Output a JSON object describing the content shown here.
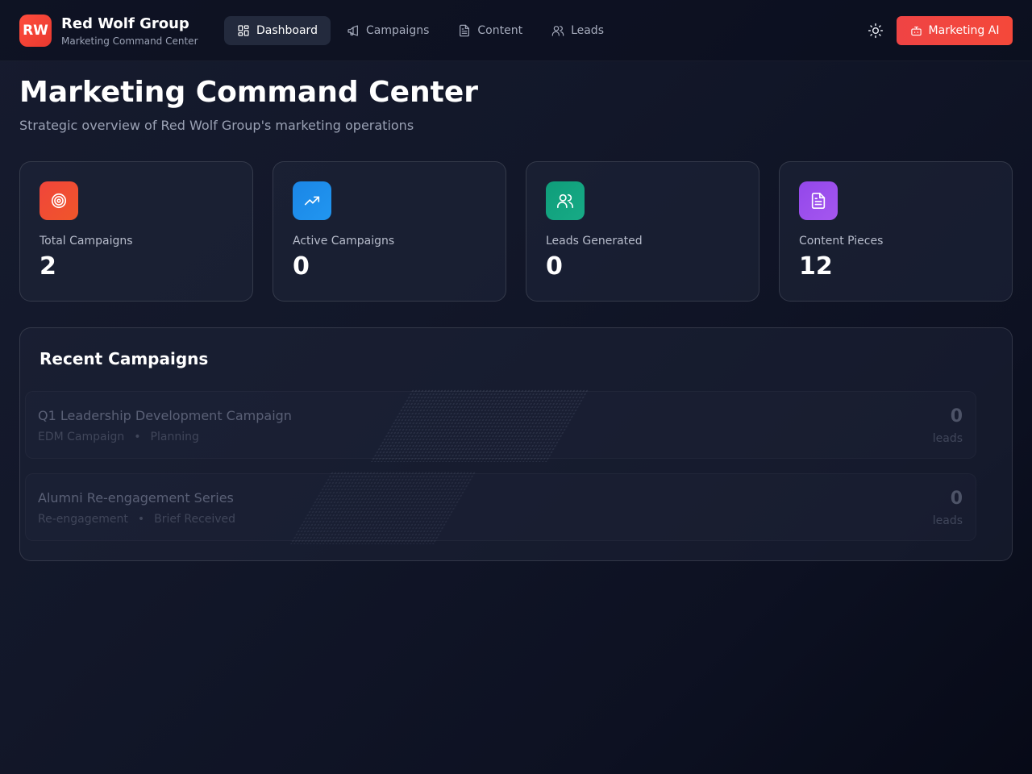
{
  "brand": {
    "logo_text": "RW",
    "name": "Red Wolf Group",
    "subtitle": "Marketing Command Center",
    "logo_color": "#ef4444"
  },
  "nav": {
    "items": [
      {
        "label": "Dashboard",
        "icon": "dashboard-icon",
        "active": true
      },
      {
        "label": "Campaigns",
        "icon": "megaphone-icon",
        "active": false
      },
      {
        "label": "Content",
        "icon": "document-icon",
        "active": false
      },
      {
        "label": "Leads",
        "icon": "users-icon",
        "active": false
      }
    ]
  },
  "header": {
    "theme_icon": "sun-icon",
    "ai_button_label": "Marketing AI",
    "ai_button_icon": "bot-icon",
    "accent": "#ef4444"
  },
  "page": {
    "title": "Marketing Command Center",
    "subtitle": "Strategic overview of Red Wolf Group's marketing operations"
  },
  "stats": [
    {
      "label": "Total Campaigns",
      "value": "2",
      "icon": "target-icon",
      "color": "#ef4f2f"
    },
    {
      "label": "Active Campaigns",
      "value": "0",
      "icon": "trending-up-icon",
      "color": "#1e8fe8"
    },
    {
      "label": "Leads Generated",
      "value": "0",
      "icon": "users-icon",
      "color": "#14a37f"
    },
    {
      "label": "Content Pieces",
      "value": "12",
      "icon": "document-icon",
      "color": "#9b4dea"
    }
  ],
  "recent": {
    "title": "Recent Campaigns",
    "separator": "•",
    "campaigns": [
      {
        "name": "Q1 Leadership Development Campaign",
        "type": "EDM Campaign",
        "status": "Planning",
        "leads": "0",
        "leads_unit": "leads"
      },
      {
        "name": "Alumni Re-engagement Series",
        "type": "Re-engagement",
        "status": "Brief Received",
        "leads": "0",
        "leads_unit": "leads"
      }
    ]
  }
}
